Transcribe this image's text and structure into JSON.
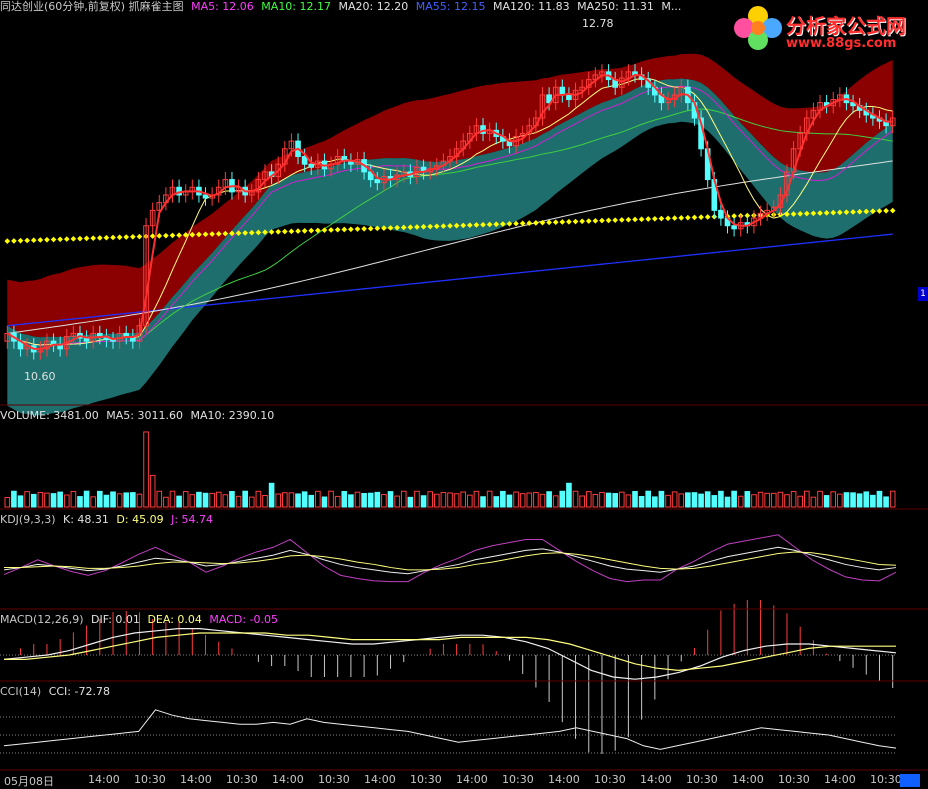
{
  "header": {
    "title": "同达创业(60分钟,前复权) 抓麻雀主图",
    "ma5": "MA5: 12.06",
    "ma10": "MA10: 12.17",
    "ma20": "MA20: 12.20",
    "ma55": "MA55: 12.15",
    "ma120": "MA120: 11.83",
    "ma250": "MA250: 11.31",
    "ma_more": "M..."
  },
  "logo": {
    "name": "分析家公式网",
    "url": "www.88gs.com"
  },
  "price_annotations": {
    "high": "12.78",
    "low": "10.60"
  },
  "volume_panel": {
    "label": "VOLUME: 3481.00",
    "ma5": "MA5: 3011.60",
    "ma10": "MA10: 2390.10"
  },
  "kdj_panel": {
    "label": "KDJ(9,3,3)",
    "k": "K: 48.31",
    "d": "D: 45.09",
    "j": "J: 54.74"
  },
  "macd_panel": {
    "label": "MACD(12,26,9)",
    "dif": "DIF: 0.01",
    "dea": "DEA: 0.04",
    "macd": "MACD: -0.05"
  },
  "cci_panel": {
    "label": "CCI(14)",
    "cci": "CCI: -72.78"
  },
  "x_axis": {
    "ticks": [
      "05月08日",
      "14:00",
      "10:30",
      "14:00",
      "10:30",
      "14:00",
      "10:30",
      "14:00",
      "10:30",
      "14:00",
      "10:30",
      "14:00",
      "10:30",
      "14:00",
      "10:30",
      "14:00",
      "10:30",
      "14:00",
      "10:30"
    ]
  },
  "colors": {
    "bg": "#000000",
    "up": "#ff3c3c",
    "down": "#54ffff",
    "band_upper": "#8b0000",
    "band_lower": "#1e6e6e",
    "ma_dotted": "#ffff00",
    "ma250": "#2030ff",
    "ma120": "#e0e0e0",
    "ma55": "#40d040",
    "ma20": "#d020d0"
  },
  "chart_data": {
    "type": "candlestick",
    "title": "同达创业(60分钟,前复权)",
    "high_marker": 12.78,
    "low_marker": 10.6,
    "ma_values": {
      "MA5": 12.06,
      "MA10": 12.17,
      "MA20": 12.2,
      "MA55": 12.15,
      "MA120": 11.83,
      "MA250": 11.31
    },
    "volume": {
      "VOLUME": 3481.0,
      "MA5": 3011.6,
      "MA10": 2390.1
    },
    "kdj": {
      "K": 48.31,
      "D": 45.09,
      "J": 54.74
    },
    "macd": {
      "DIF": 0.01,
      "DEA": 0.04,
      "MACD": -0.05
    },
    "cci": [
      -60,
      -50,
      -40,
      -30,
      -20,
      -10,
      0,
      10,
      20,
      140,
      110,
      90,
      80,
      70,
      60,
      60,
      70,
      60,
      90,
      70,
      60,
      50,
      40,
      30,
      20,
      0,
      -20,
      -40,
      -30,
      -20,
      -10,
      0,
      10,
      20,
      40,
      20,
      0,
      -20,
      -60,
      -80,
      -60,
      -40,
      -20,
      0,
      20,
      40,
      30,
      20,
      10,
      0,
      -20,
      -40,
      -60,
      -72.78
    ],
    "close": [
      10.9,
      10.85,
      10.8,
      10.82,
      10.78,
      10.8,
      10.85,
      10.83,
      10.8,
      10.88,
      10.9,
      10.87,
      10.85,
      10.9,
      10.88,
      10.86,
      10.85,
      10.9,
      10.88,
      10.85,
      10.95,
      11.6,
      11.7,
      11.75,
      11.8,
      11.85,
      11.8,
      11.82,
      11.85,
      11.8,
      11.78,
      11.8,
      11.85,
      11.9,
      11.82,
      11.85,
      11.8,
      11.82,
      11.9,
      11.95,
      11.92,
      12.0,
      12.1,
      12.15,
      12.05,
      12.0,
      11.98,
      12.02,
      11.97,
      12.0,
      12.05,
      12.02,
      12.0,
      12.03,
      11.95,
      11.9,
      11.88,
      11.92,
      11.9,
      11.93,
      11.95,
      11.92,
      11.98,
      11.95,
      11.97,
      11.99,
      12.02,
      12.05,
      12.1,
      12.15,
      12.2,
      12.25,
      12.2,
      12.22,
      12.18,
      12.15,
      12.12,
      12.18,
      12.2,
      12.25,
      12.3,
      12.45,
      12.4,
      12.5,
      12.45,
      12.42,
      12.48,
      12.5,
      12.55,
      12.58,
      12.6,
      12.55,
      12.5,
      12.56,
      12.6,
      12.58,
      12.55,
      12.5,
      12.45,
      12.4,
      12.42,
      12.45,
      12.5,
      12.4,
      12.3,
      12.1,
      11.9,
      11.7,
      11.65,
      11.6,
      11.58,
      11.62,
      11.6,
      11.65,
      11.68,
      11.7,
      11.72,
      11.8,
      11.95,
      12.1,
      12.2,
      12.3,
      12.35,
      12.4,
      12.38,
      12.42,
      12.45,
      12.4,
      12.38,
      12.35,
      12.32,
      12.3,
      12.28,
      12.25,
      12.3
    ],
    "open": [
      10.85,
      10.9,
      10.85,
      10.8,
      10.82,
      10.78,
      10.8,
      10.85,
      10.83,
      10.8,
      10.88,
      10.9,
      10.87,
      10.85,
      10.9,
      10.88,
      10.86,
      10.85,
      10.9,
      10.88,
      10.85,
      10.95,
      11.6,
      11.7,
      11.75,
      11.8,
      11.85,
      11.8,
      11.82,
      11.85,
      11.8,
      11.78,
      11.8,
      11.85,
      11.9,
      11.82,
      11.85,
      11.8,
      11.82,
      11.9,
      11.95,
      11.92,
      12.0,
      12.1,
      12.15,
      12.05,
      12.0,
      11.98,
      12.02,
      11.97,
      12.0,
      12.05,
      12.02,
      12.0,
      12.03,
      11.95,
      11.9,
      11.88,
      11.92,
      11.9,
      11.93,
      11.95,
      11.92,
      11.98,
      11.95,
      11.97,
      11.99,
      12.02,
      12.05,
      12.1,
      12.15,
      12.2,
      12.25,
      12.2,
      12.22,
      12.18,
      12.15,
      12.12,
      12.18,
      12.2,
      12.25,
      12.3,
      12.45,
      12.4,
      12.5,
      12.45,
      12.42,
      12.48,
      12.5,
      12.55,
      12.58,
      12.6,
      12.55,
      12.5,
      12.56,
      12.6,
      12.58,
      12.55,
      12.5,
      12.45,
      12.4,
      12.42,
      12.45,
      12.5,
      12.4,
      12.3,
      12.1,
      11.9,
      11.7,
      11.65,
      11.6,
      11.58,
      11.62,
      11.6,
      11.65,
      11.68,
      11.7,
      11.72,
      11.8,
      11.95,
      12.1,
      12.2,
      12.3,
      12.35,
      12.4,
      12.38,
      12.42,
      12.45,
      12.4,
      12.38,
      12.35,
      12.32,
      12.3,
      12.28,
      12.25
    ],
    "kdj_k": [
      45,
      48,
      52,
      50,
      47,
      44,
      46,
      50,
      55,
      60,
      58,
      55,
      50,
      52,
      56,
      60,
      64,
      70,
      65,
      58,
      52,
      48,
      45,
      42,
      40,
      44,
      48,
      52,
      58,
      62,
      66,
      70,
      72,
      68,
      62,
      56,
      50,
      46,
      44,
      42,
      46,
      50,
      56,
      62,
      66,
      70,
      74,
      70,
      64,
      58,
      52,
      48,
      45,
      48
    ],
    "kdj_d": [
      48,
      48,
      49,
      50,
      49,
      47,
      47,
      48,
      50,
      53,
      55,
      55,
      54,
      53,
      54,
      56,
      59,
      63,
      64,
      62,
      59,
      55,
      52,
      48,
      45,
      45,
      46,
      48,
      52,
      55,
      59,
      63,
      66,
      67,
      65,
      62,
      58,
      54,
      50,
      47,
      46,
      47,
      50,
      54,
      58,
      62,
      66,
      68,
      67,
      64,
      60,
      56,
      52,
      51
    ],
    "macd_dif": [
      -0.02,
      -0.01,
      0.0,
      0.02,
      0.05,
      0.08,
      0.1,
      0.11,
      0.12,
      0.12,
      0.11,
      0.1,
      0.09,
      0.08,
      0.07,
      0.06,
      0.05,
      0.05,
      0.06,
      0.07,
      0.08,
      0.09,
      0.09,
      0.08,
      0.06,
      0.03,
      -0.02,
      -0.07,
      -0.1,
      -0.11,
      -0.1,
      -0.08,
      -0.05,
      -0.01,
      0.02,
      0.04,
      0.05,
      0.05,
      0.04,
      0.03,
      0.02,
      0.01
    ],
    "macd_dea": [
      -0.02,
      -0.02,
      -0.01,
      0.0,
      0.02,
      0.04,
      0.06,
      0.08,
      0.09,
      0.1,
      0.1,
      0.1,
      0.1,
      0.09,
      0.09,
      0.08,
      0.07,
      0.07,
      0.07,
      0.07,
      0.07,
      0.08,
      0.08,
      0.08,
      0.08,
      0.07,
      0.05,
      0.02,
      -0.01,
      -0.04,
      -0.06,
      -0.07,
      -0.06,
      -0.05,
      -0.03,
      -0.01,
      0.01,
      0.03,
      0.04,
      0.04,
      0.04,
      0.04
    ]
  }
}
